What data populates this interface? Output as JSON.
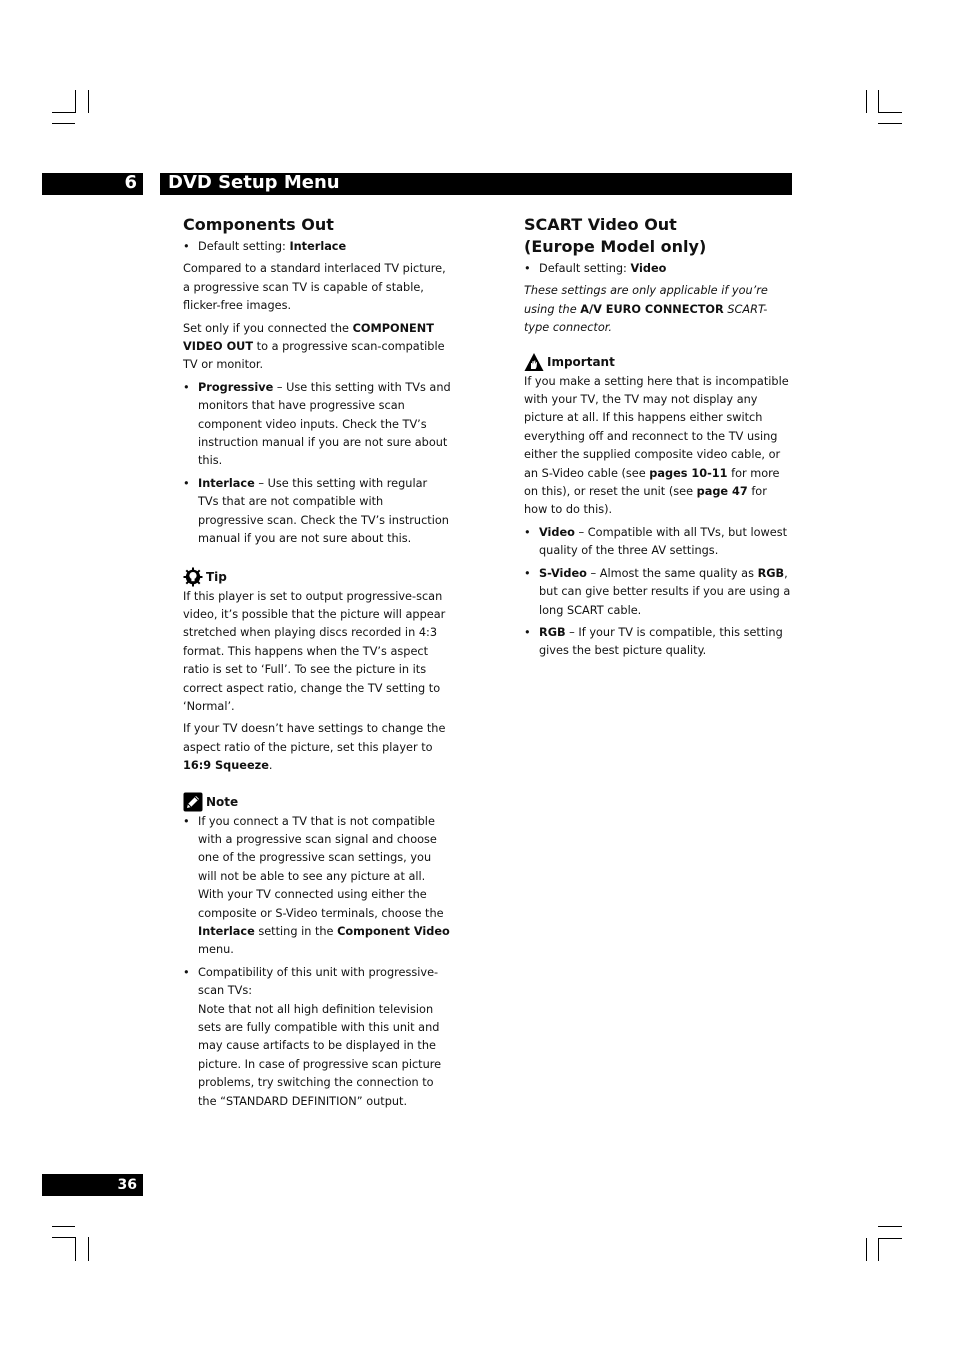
{
  "header": {
    "chapter_number": "6",
    "chapter_title": "DVD Setup Menu"
  },
  "footer": {
    "page_number": "36"
  },
  "left": {
    "title": "Components Out",
    "default": {
      "label": "Default setting: ",
      "value": "Interlace"
    },
    "intro": "Compared to a standard interlaced TV picture, a progressive scan TV is capable of stable, flicker-free images.",
    "set_only": {
      "pre": "Set only if you connected the ",
      "bold": "COMPONENT VIDEO OUT",
      "post": " to a progressive scan-compatible TV or monitor."
    },
    "options": [
      {
        "name": "Progressive",
        "desc": " – Use this setting with TVs and monitors that have progressive scan component video inputs. Check the TV’s instruction manual if you are not sure about this."
      },
      {
        "name": "Interlace",
        "desc": " – Use this setting with regular TVs that are not compatible with progressive scan. Check the TV’s instruction manual if you are not sure about this."
      }
    ],
    "tip": {
      "icon": "lightbulb-gear-icon",
      "label": "Tip",
      "para1": "If this player is set to output progressive-scan video, it’s possible that the picture will appear stretched when playing discs recorded in 4:3 format. This happens when the TV’s aspect ratio is set to ‘Full’. To see the picture in its correct aspect ratio, change the TV setting to ‘Normal’.",
      "para2_pre": "If your TV doesn’t have settings to change the aspect ratio of the picture, set this player to ",
      "para2_bold": "16:9 Squeeze",
      "para2_post": "."
    },
    "note": {
      "icon": "pencil-icon",
      "label": "Note",
      "item1_pre": "If you connect a TV that is not compatible with a progressive scan signal and choose one of the progressive scan settings, you will not be able to see any picture at all. With your TV connected using either the composite or S-Video terminals, choose the ",
      "item1_bold1": "Interlace",
      "item1_mid": " setting in the ",
      "item1_bold2": "Component Video",
      "item1_post": " menu.",
      "item2_line1": "Compatibility of this unit with progressive-scan TVs:",
      "item2_line2": "Note that not all high definition television sets are fully compatible with this unit and may cause artifacts to be displayed in the picture. In case of progressive scan picture problems, try switching the connection to the “STANDARD DEFINITION” output."
    }
  },
  "right": {
    "title_line1": "SCART Video Out",
    "title_line2": "(Europe Model only)",
    "default": {
      "label": "Default setting: ",
      "value": "Video"
    },
    "applicability_pre": "These settings are only applicable if you’re using the ",
    "applicability_bold": "A/V EURO CONNECTOR",
    "applicability_post": " SCART-type connector.",
    "important": {
      "icon": "warning-hand-icon",
      "label": "Important",
      "text_pre": "If you make a setting here that is incompatible with your TV, the TV may not display any picture at all. If this happens either switch everything off and reconnect to the TV using either the supplied composite video cable, or an S-Video cable (see ",
      "text_bold1": "pages 10-11",
      "text_mid": " for more on this), or reset the unit (see ",
      "text_bold2": "page 47",
      "text_post": " for how to do this)."
    },
    "options": [
      {
        "name": "Video",
        "desc": " – Compatible with all TVs, but lowest quality of the three AV settings."
      },
      {
        "name": "S-Video",
        "desc_pre": " – Almost the same quality as ",
        "desc_bold": "RGB",
        "desc_post": ", but can give better results if you are using a long SCART cable."
      },
      {
        "name": "RGB",
        "desc": " – If your TV is compatible, this setting gives the best picture quality."
      }
    ]
  }
}
